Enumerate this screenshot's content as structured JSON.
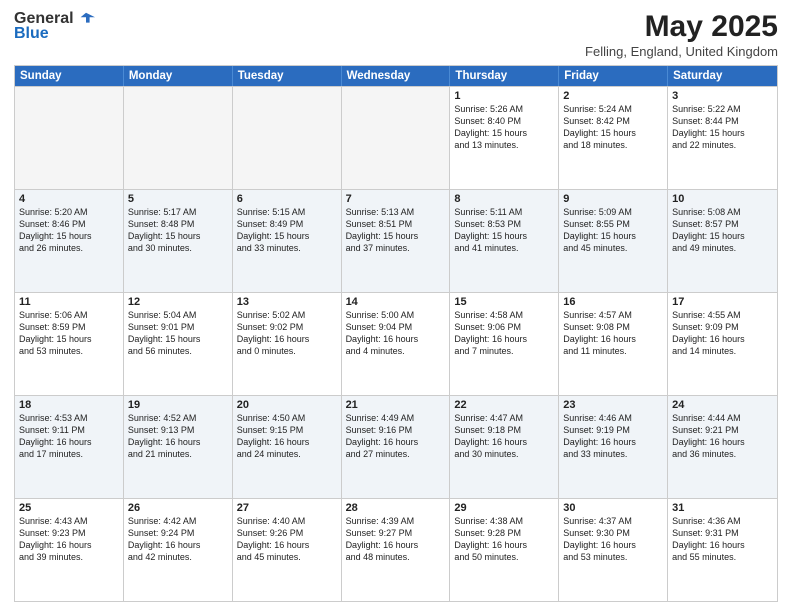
{
  "header": {
    "logo_general": "General",
    "logo_blue": "Blue",
    "title": "May 2025",
    "subtitle": "Felling, England, United Kingdom"
  },
  "days_of_week": [
    "Sunday",
    "Monday",
    "Tuesday",
    "Wednesday",
    "Thursday",
    "Friday",
    "Saturday"
  ],
  "weeks": [
    [
      {
        "day": "",
        "info": "",
        "empty": true
      },
      {
        "day": "",
        "info": "",
        "empty": true
      },
      {
        "day": "",
        "info": "",
        "empty": true
      },
      {
        "day": "",
        "info": "",
        "empty": true
      },
      {
        "day": "1",
        "info": "Sunrise: 5:26 AM\nSunset: 8:40 PM\nDaylight: 15 hours\nand 13 minutes.",
        "empty": false
      },
      {
        "day": "2",
        "info": "Sunrise: 5:24 AM\nSunset: 8:42 PM\nDaylight: 15 hours\nand 18 minutes.",
        "empty": false
      },
      {
        "day": "3",
        "info": "Sunrise: 5:22 AM\nSunset: 8:44 PM\nDaylight: 15 hours\nand 22 minutes.",
        "empty": false
      }
    ],
    [
      {
        "day": "4",
        "info": "Sunrise: 5:20 AM\nSunset: 8:46 PM\nDaylight: 15 hours\nand 26 minutes.",
        "empty": false
      },
      {
        "day": "5",
        "info": "Sunrise: 5:17 AM\nSunset: 8:48 PM\nDaylight: 15 hours\nand 30 minutes.",
        "empty": false
      },
      {
        "day": "6",
        "info": "Sunrise: 5:15 AM\nSunset: 8:49 PM\nDaylight: 15 hours\nand 33 minutes.",
        "empty": false
      },
      {
        "day": "7",
        "info": "Sunrise: 5:13 AM\nSunset: 8:51 PM\nDaylight: 15 hours\nand 37 minutes.",
        "empty": false
      },
      {
        "day": "8",
        "info": "Sunrise: 5:11 AM\nSunset: 8:53 PM\nDaylight: 15 hours\nand 41 minutes.",
        "empty": false
      },
      {
        "day": "9",
        "info": "Sunrise: 5:09 AM\nSunset: 8:55 PM\nDaylight: 15 hours\nand 45 minutes.",
        "empty": false
      },
      {
        "day": "10",
        "info": "Sunrise: 5:08 AM\nSunset: 8:57 PM\nDaylight: 15 hours\nand 49 minutes.",
        "empty": false
      }
    ],
    [
      {
        "day": "11",
        "info": "Sunrise: 5:06 AM\nSunset: 8:59 PM\nDaylight: 15 hours\nand 53 minutes.",
        "empty": false
      },
      {
        "day": "12",
        "info": "Sunrise: 5:04 AM\nSunset: 9:01 PM\nDaylight: 15 hours\nand 56 minutes.",
        "empty": false
      },
      {
        "day": "13",
        "info": "Sunrise: 5:02 AM\nSunset: 9:02 PM\nDaylight: 16 hours\nand 0 minutes.",
        "empty": false
      },
      {
        "day": "14",
        "info": "Sunrise: 5:00 AM\nSunset: 9:04 PM\nDaylight: 16 hours\nand 4 minutes.",
        "empty": false
      },
      {
        "day": "15",
        "info": "Sunrise: 4:58 AM\nSunset: 9:06 PM\nDaylight: 16 hours\nand 7 minutes.",
        "empty": false
      },
      {
        "day": "16",
        "info": "Sunrise: 4:57 AM\nSunset: 9:08 PM\nDaylight: 16 hours\nand 11 minutes.",
        "empty": false
      },
      {
        "day": "17",
        "info": "Sunrise: 4:55 AM\nSunset: 9:09 PM\nDaylight: 16 hours\nand 14 minutes.",
        "empty": false
      }
    ],
    [
      {
        "day": "18",
        "info": "Sunrise: 4:53 AM\nSunset: 9:11 PM\nDaylight: 16 hours\nand 17 minutes.",
        "empty": false
      },
      {
        "day": "19",
        "info": "Sunrise: 4:52 AM\nSunset: 9:13 PM\nDaylight: 16 hours\nand 21 minutes.",
        "empty": false
      },
      {
        "day": "20",
        "info": "Sunrise: 4:50 AM\nSunset: 9:15 PM\nDaylight: 16 hours\nand 24 minutes.",
        "empty": false
      },
      {
        "day": "21",
        "info": "Sunrise: 4:49 AM\nSunset: 9:16 PM\nDaylight: 16 hours\nand 27 minutes.",
        "empty": false
      },
      {
        "day": "22",
        "info": "Sunrise: 4:47 AM\nSunset: 9:18 PM\nDaylight: 16 hours\nand 30 minutes.",
        "empty": false
      },
      {
        "day": "23",
        "info": "Sunrise: 4:46 AM\nSunset: 9:19 PM\nDaylight: 16 hours\nand 33 minutes.",
        "empty": false
      },
      {
        "day": "24",
        "info": "Sunrise: 4:44 AM\nSunset: 9:21 PM\nDaylight: 16 hours\nand 36 minutes.",
        "empty": false
      }
    ],
    [
      {
        "day": "25",
        "info": "Sunrise: 4:43 AM\nSunset: 9:23 PM\nDaylight: 16 hours\nand 39 minutes.",
        "empty": false
      },
      {
        "day": "26",
        "info": "Sunrise: 4:42 AM\nSunset: 9:24 PM\nDaylight: 16 hours\nand 42 minutes.",
        "empty": false
      },
      {
        "day": "27",
        "info": "Sunrise: 4:40 AM\nSunset: 9:26 PM\nDaylight: 16 hours\nand 45 minutes.",
        "empty": false
      },
      {
        "day": "28",
        "info": "Sunrise: 4:39 AM\nSunset: 9:27 PM\nDaylight: 16 hours\nand 48 minutes.",
        "empty": false
      },
      {
        "day": "29",
        "info": "Sunrise: 4:38 AM\nSunset: 9:28 PM\nDaylight: 16 hours\nand 50 minutes.",
        "empty": false
      },
      {
        "day": "30",
        "info": "Sunrise: 4:37 AM\nSunset: 9:30 PM\nDaylight: 16 hours\nand 53 minutes.",
        "empty": false
      },
      {
        "day": "31",
        "info": "Sunrise: 4:36 AM\nSunset: 9:31 PM\nDaylight: 16 hours\nand 55 minutes.",
        "empty": false
      }
    ]
  ]
}
